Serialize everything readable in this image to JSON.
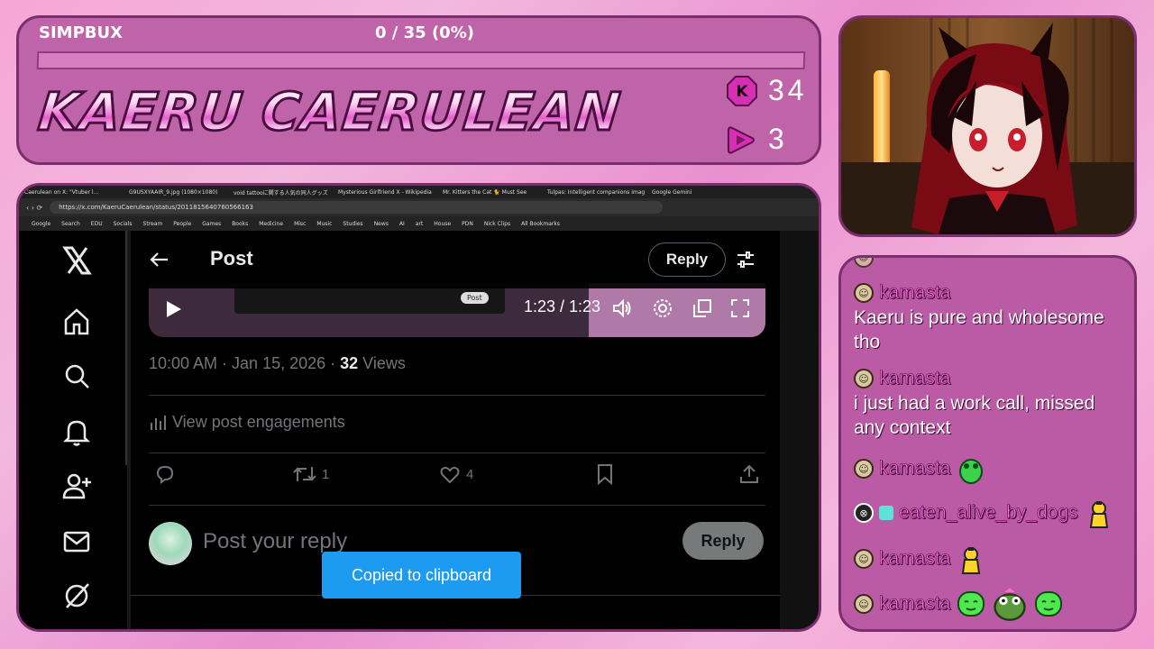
{
  "banner": {
    "goal_label": "SIMPBUX",
    "goal_progress": "0 / 35 (0%)",
    "goal_fraction": 0,
    "streamer_name": "KAERU CAERULEAN",
    "kick_count": "34",
    "rumble_count": "3"
  },
  "browser": {
    "tabs": [
      "Caerulean on X: \"Vtuber l...",
      "G9USXYAAIR_9.jpg (1080×1080)",
      "void tattooに関する人気の同人グッズ",
      "Mysterious Girlfriend X - Wikipedia",
      "Mr. Kitters the Cat 🐈 Must See",
      "Tulpas: Intelligent companions imag",
      "Google Gemini"
    ],
    "url": "https://x.com/KaeruCaerulean/status/2011815640760566163",
    "bookmarks": [
      "Google",
      "Search",
      "EDU",
      "Socials",
      "Stream",
      "People",
      "Games",
      "Books",
      "Medicine",
      "Misc",
      "Music",
      "Studies",
      "News",
      "AI",
      "art",
      "House",
      "PDN",
      "Nick Clips",
      "All Bookmarks"
    ]
  },
  "x": {
    "header_title": "Post",
    "reply_button": "Reply",
    "video_time": "1:23 / 1:23",
    "video_post_chip": "Post",
    "timestamp": "10:00 AM · Jan 15, 2026 · ",
    "views_count": "32",
    "views_label": " Views",
    "engagements": "View post engagements",
    "retweet_count": "1",
    "like_count": "4",
    "reply_placeholder": "Post your reply",
    "reply_submit": "Reply",
    "toast": "Copied to clipboard"
  },
  "chat": {
    "messages": [
      {
        "user": "kamasta",
        "text": "Kaeru is pure and wholesome tho"
      },
      {
        "user": "kamasta",
        "text": "i just had a work call, missed any context"
      },
      {
        "user": "kamasta",
        "text": ""
      },
      {
        "user": "eaten_alive_by_dogs",
        "text": ""
      },
      {
        "user": "kamasta",
        "text": ""
      },
      {
        "user": "kamasta",
        "text": ""
      }
    ]
  },
  "colors": {
    "accent_pink": "#c064aa",
    "chat_name": "#ff66dd",
    "x_blue": "#1d9bf0"
  },
  "icons": [
    "kick-icon",
    "rumble-icon",
    "x-logo-icon",
    "home-icon",
    "search-icon",
    "bell-icon",
    "add-user-icon",
    "mail-icon",
    "grok-icon",
    "back-arrow-icon",
    "sliders-icon",
    "play-icon",
    "volume-icon",
    "settings-icon",
    "pip-icon",
    "fullscreen-icon",
    "chart-icon",
    "reply-icon",
    "retweet-icon",
    "heart-icon",
    "bookmark-icon",
    "share-icon"
  ]
}
